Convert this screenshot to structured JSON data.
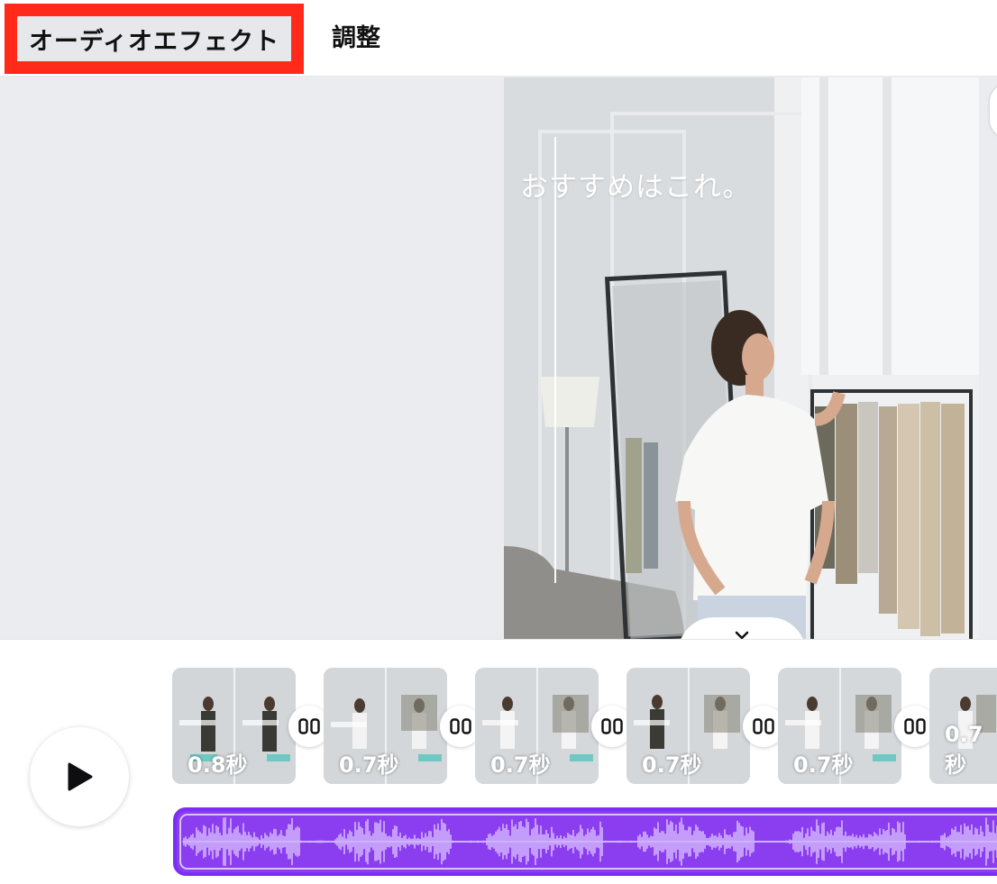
{
  "tabs": {
    "audio_effects": "オーディオエフェクト",
    "adjust": "調整"
  },
  "preview": {
    "overlay_text": "おすすめはこれ。"
  },
  "timeline": {
    "clips": [
      {
        "duration": "0.8秒"
      },
      {
        "duration": "0.7秒"
      },
      {
        "duration": "0.7秒"
      },
      {
        "duration": "0.7秒"
      },
      {
        "duration": "0.7秒"
      },
      {
        "duration": "0.7秒"
      }
    ]
  },
  "icons": {
    "play": "play-icon",
    "collapse": "chevron-down-icon",
    "transition": "transition-icon"
  },
  "colors": {
    "highlight": "#ff2a1a",
    "audio_track": "#8b3df0",
    "waveform": "#dcc6ff"
  }
}
